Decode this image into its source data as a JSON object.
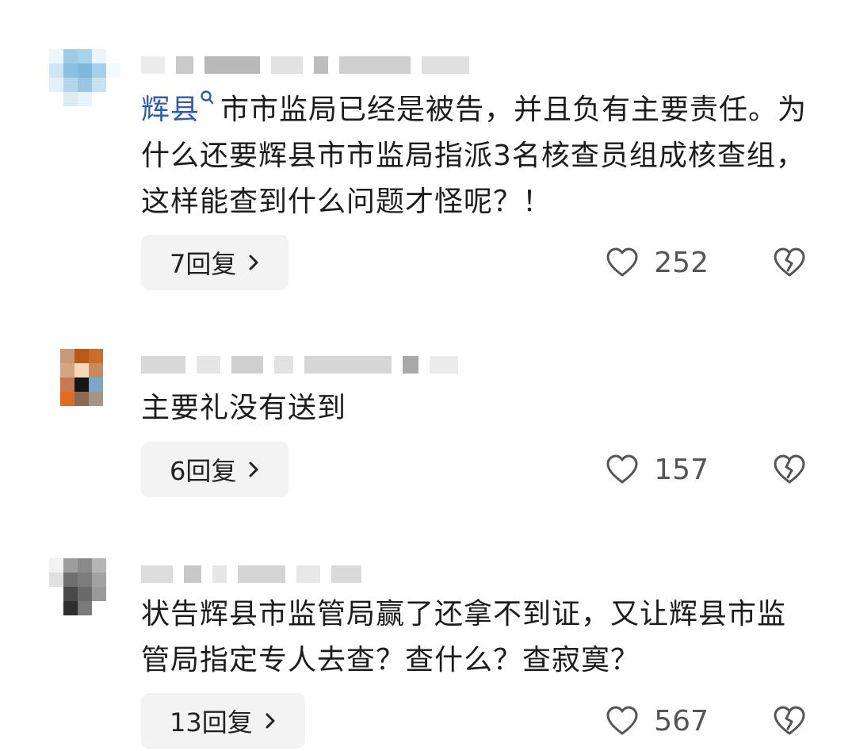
{
  "comments": [
    {
      "tag": "辉县",
      "text": "市市监局已经是被告，并且负有主要责任。为什么还要辉县市市监局指派3名核查员组成核查组，这样能查到什么问题才怪呢？！",
      "reply_label": "7回复",
      "likes": "252"
    },
    {
      "tag": "",
      "text": "主要礼没有送到",
      "reply_label": "6回复",
      "likes": "157"
    },
    {
      "tag": "",
      "text": "状告辉县市监管局赢了还拿不到证，又让辉县市监管局指定专人去查？查什么？查寂寞？",
      "reply_label": "13回复",
      "likes": "567"
    }
  ],
  "icons": {
    "tag": "search-icon",
    "reply_chevron": "chevron-right-icon",
    "like": "heart-icon",
    "dislike": "broken-heart-icon"
  },
  "colors": {
    "tag": "#2f5bb7",
    "text": "#1c1c1c",
    "reply_bg": "#f3f3f3",
    "meta": "#555555"
  }
}
